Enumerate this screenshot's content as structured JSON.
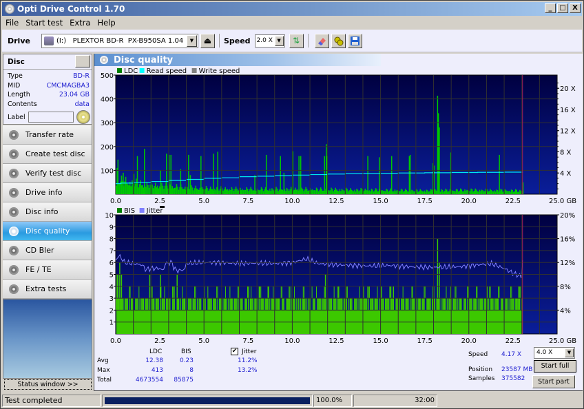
{
  "window": {
    "title": "Opti Drive Control 1.70",
    "controls": [
      "_",
      "□",
      "X"
    ]
  },
  "menu": [
    "File",
    "Start test",
    "Extra",
    "Help"
  ],
  "toolbar": {
    "drive_label": "Drive",
    "drive_value": "(I:)   PLEXTOR BD-R  PX-B950SA 1.04",
    "speed_label": "Speed",
    "speed_value": "2.0 X",
    "icons": [
      "eject-icon",
      "refresh-icon",
      "erase-icon",
      "settings-icon",
      "save-icon"
    ]
  },
  "disc": {
    "header": "Disc",
    "fields": [
      {
        "key": "Type",
        "value": "BD-R"
      },
      {
        "key": "MID",
        "value": "CMCMAGBA3"
      },
      {
        "key": "Length",
        "value": "23.04 GB"
      },
      {
        "key": "Contents",
        "value": "data"
      }
    ],
    "label_key": "Label",
    "label_value": ""
  },
  "nav": [
    {
      "label": "Transfer rate",
      "active": false
    },
    {
      "label": "Create test disc",
      "active": false
    },
    {
      "label": "Verify test disc",
      "active": false
    },
    {
      "label": "Drive info",
      "active": false
    },
    {
      "label": "Disc info",
      "active": false
    },
    {
      "label": "Disc quality",
      "active": true
    },
    {
      "label": "CD Bler",
      "active": false
    },
    {
      "label": "FE / TE",
      "active": false
    },
    {
      "label": "Extra tests",
      "active": false
    }
  ],
  "status_window_button": "Status window >>",
  "panel_title": "Disc quality",
  "colors": {
    "plot_bg_top": "#000040",
    "plot_bg_bottom": "#0a1e9a",
    "ldc": "#00c800",
    "bis": "#3cc800",
    "read_speed": "#00e8f0",
    "jitter": "#8080ff",
    "end_marker": "#a0205a",
    "grid": "#303030"
  },
  "chart_data": [
    {
      "type": "bar",
      "title": "LDC / Read speed",
      "legend": [
        {
          "label": "LDC",
          "color": "#008000"
        },
        {
          "label": "Read speed",
          "color": "#00ffff"
        },
        {
          "label": "Write speed",
          "color": "#808080"
        }
      ],
      "xlabel": "GB",
      "x_ticks": [
        "0.0",
        "2.5",
        "5.0",
        "7.5",
        "10.0",
        "12.5",
        "15.0",
        "17.5",
        "20.0",
        "22.5",
        "25.0 GB"
      ],
      "xlim": [
        0,
        25
      ],
      "ylim": [
        0,
        500
      ],
      "y_ticks": [
        "100",
        "200",
        "300",
        "400",
        "500"
      ],
      "y2lim": [
        0,
        22.5
      ],
      "y2_ticks": [
        "4 X",
        "8 X",
        "12 X",
        "16 X",
        "20 X"
      ],
      "data_end_gb": 23.04,
      "ldc_baseline": [
        [
          0.0,
          60
        ],
        [
          0.5,
          55
        ],
        [
          1.0,
          48
        ],
        [
          2.0,
          40
        ],
        [
          3.0,
          35
        ],
        [
          4.0,
          28
        ],
        [
          5.0,
          25
        ],
        [
          7.5,
          22
        ],
        [
          10.0,
          22
        ],
        [
          12.5,
          20
        ],
        [
          15.0,
          18
        ],
        [
          17.5,
          16
        ],
        [
          20.0,
          18
        ],
        [
          22.5,
          16
        ],
        [
          23.0,
          15
        ]
      ],
      "ldc_spikes": [
        [
          0.05,
          110
        ],
        [
          0.1,
          145
        ],
        [
          0.4,
          90
        ],
        [
          1.0,
          85
        ],
        [
          1.2,
          160
        ],
        [
          1.6,
          190
        ],
        [
          2.5,
          100
        ],
        [
          2.85,
          170
        ],
        [
          3.0,
          165
        ],
        [
          3.1,
          165
        ],
        [
          3.65,
          105
        ],
        [
          4.1,
          165
        ],
        [
          4.2,
          80
        ],
        [
          4.8,
          160
        ],
        [
          5.5,
          170
        ],
        [
          5.75,
          178
        ],
        [
          7.85,
          80
        ],
        [
          8.5,
          165
        ],
        [
          9.3,
          160
        ],
        [
          9.5,
          90
        ],
        [
          10.0,
          180
        ],
        [
          10.35,
          160
        ],
        [
          10.45,
          160
        ],
        [
          11.8,
          160
        ],
        [
          11.9,
          210
        ],
        [
          11.95,
          160
        ],
        [
          14.25,
          160
        ],
        [
          14.9,
          155
        ],
        [
          15.6,
          160
        ],
        [
          16.6,
          160
        ],
        [
          16.65,
          165
        ],
        [
          17.95,
          130
        ],
        [
          18.0,
          120
        ],
        [
          18.2,
          413
        ],
        [
          18.25,
          340
        ],
        [
          18.3,
          280
        ],
        [
          18.95,
          175
        ],
        [
          21.7,
          165
        ]
      ],
      "read_speed": [
        [
          0.0,
          2.0
        ],
        [
          0.3,
          2.1
        ],
        [
          1.0,
          2.2
        ],
        [
          2.0,
          2.4
        ],
        [
          3.0,
          2.6
        ],
        [
          4.0,
          2.8
        ],
        [
          5.0,
          3.0
        ],
        [
          6.0,
          3.1
        ],
        [
          7.0,
          3.3
        ],
        [
          8.0,
          3.4
        ],
        [
          9.0,
          3.5
        ],
        [
          10.0,
          3.6
        ],
        [
          11.0,
          3.7
        ],
        [
          12.0,
          3.8
        ],
        [
          13.0,
          3.85
        ],
        [
          14.0,
          3.9
        ],
        [
          15.0,
          3.95
        ],
        [
          16.0,
          4.0
        ],
        [
          17.5,
          4.05
        ],
        [
          19.0,
          4.1
        ],
        [
          20.5,
          4.13
        ],
        [
          22.0,
          4.16
        ],
        [
          23.04,
          4.17
        ]
      ]
    },
    {
      "type": "bar",
      "title": "BIS / Jitter",
      "legend": [
        {
          "label": "BIS",
          "color": "#008000"
        },
        {
          "label": "Jitter",
          "color": "#8080ff"
        }
      ],
      "xlabel": "GB",
      "x_ticks": [
        "0.0",
        "2.5",
        "5.0",
        "7.5",
        "10.0",
        "12.5",
        "15.0",
        "17.5",
        "20.0",
        "22.5",
        "25.0 GB"
      ],
      "xlim": [
        0,
        25
      ],
      "ylim": [
        0,
        10
      ],
      "y_ticks": [
        "1",
        "2",
        "3",
        "4",
        "5",
        "6",
        "7",
        "8",
        "9",
        "10"
      ],
      "y2lim": [
        0,
        20
      ],
      "y2_ticks": [
        "4%",
        "8%",
        "12%",
        "16%",
        "20%"
      ],
      "data_end_gb": 23.04,
      "bis_base": 2,
      "bis_common": 3,
      "bis_spikes": [
        [
          0.05,
          5
        ],
        [
          0.1,
          5
        ],
        [
          0.2,
          6
        ],
        [
          0.3,
          5
        ],
        [
          1.9,
          5
        ],
        [
          2.5,
          5
        ],
        [
          3.45,
          5
        ],
        [
          7.5,
          4
        ],
        [
          8.1,
          4
        ],
        [
          8.6,
          4
        ],
        [
          9.8,
          4
        ],
        [
          11.85,
          5
        ],
        [
          12.6,
          4
        ],
        [
          14.0,
          4
        ],
        [
          15.55,
          4
        ],
        [
          15.7,
          4
        ],
        [
          18.2,
          8
        ],
        [
          18.3,
          6
        ],
        [
          18.95,
          4
        ],
        [
          19.5,
          3
        ],
        [
          21.0,
          4
        ],
        [
          22.8,
          4
        ]
      ],
      "jitter": [
        [
          0.0,
          12.4
        ],
        [
          0.2,
          13.2
        ],
        [
          0.5,
          12.0
        ],
        [
          1.0,
          11.8
        ],
        [
          1.5,
          11.6
        ],
        [
          1.7,
          10.8
        ],
        [
          2.0,
          11.0
        ],
        [
          2.5,
          11.0
        ],
        [
          2.7,
          10.6
        ],
        [
          2.8,
          11.8
        ],
        [
          3.2,
          12.0
        ],
        [
          3.3,
          11.0
        ],
        [
          3.5,
          10.6
        ],
        [
          3.9,
          10.8
        ],
        [
          4.0,
          11.8
        ],
        [
          5.0,
          12.0
        ],
        [
          6.0,
          12.0
        ],
        [
          7.0,
          11.8
        ],
        [
          8.0,
          11.9
        ],
        [
          9.0,
          11.8
        ],
        [
          10.0,
          12.0
        ],
        [
          10.8,
          12.6
        ],
        [
          11.5,
          11.8
        ],
        [
          12.5,
          11.6
        ],
        [
          13.5,
          11.5
        ],
        [
          14.5,
          11.4
        ],
        [
          15.5,
          11.5
        ],
        [
          16.5,
          11.3
        ],
        [
          17.5,
          11.2
        ],
        [
          18.5,
          11.2
        ],
        [
          19.5,
          11.3
        ],
        [
          20.5,
          11.6
        ],
        [
          21.3,
          11.8
        ],
        [
          22.0,
          11.0
        ],
        [
          22.5,
          10.2
        ],
        [
          23.0,
          9.6
        ]
      ]
    }
  ],
  "stats": {
    "col_ldc": "LDC",
    "col_bis": "BIS",
    "jitter_label": "Jitter",
    "jitter_checked": true,
    "rows": [
      {
        "label": "Avg",
        "ldc": "12.38",
        "bis": "0.23",
        "jitter": "11.2%"
      },
      {
        "label": "Max",
        "ldc": "413",
        "bis": "8",
        "jitter": "13.2%"
      },
      {
        "label": "Total",
        "ldc": "4673554",
        "bis": "85875",
        "jitter": ""
      }
    ]
  },
  "run": {
    "speed_label": "Speed",
    "speed_value": "4.17 X",
    "position_label": "Position",
    "position_value": "23587 MB",
    "samples_label": "Samples",
    "samples_value": "375582",
    "speed_select": "4.0 X",
    "start_full": "Start full",
    "start_part": "Start part"
  },
  "statusbar": {
    "message": "Test completed",
    "progress_percent": 100,
    "progress_text": "100.0%",
    "elapsed": "32:00"
  }
}
